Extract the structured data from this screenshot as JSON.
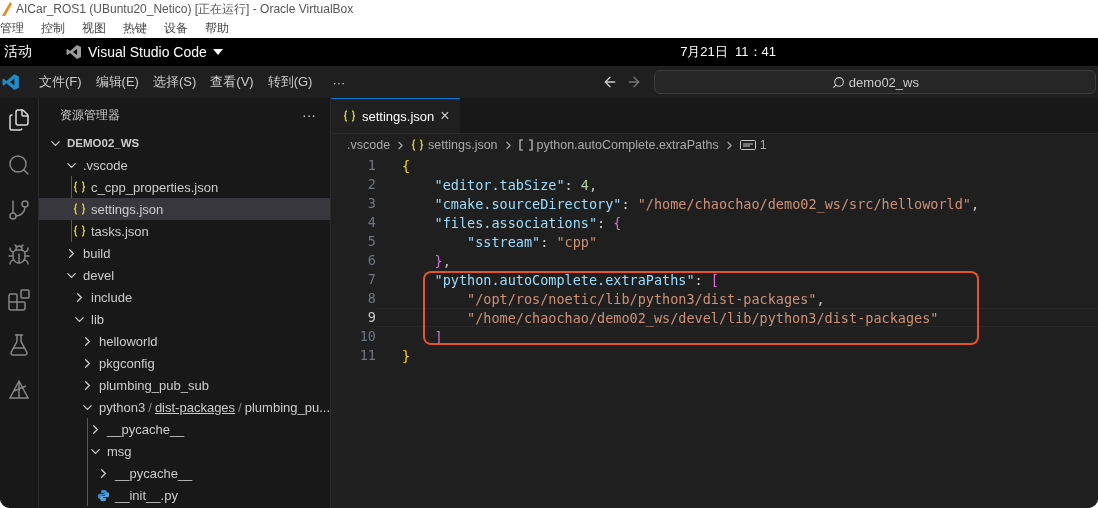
{
  "host_window": {
    "title": "AICar_ROS1 (UBuntu20_Netico) [正在运行] - Oracle VirtualBox",
    "menu": [
      "管理",
      "控制",
      "视图",
      "热键",
      "设备",
      "帮助"
    ]
  },
  "top_bar": {
    "activities": "活动",
    "app_name": "Visual Studio Code",
    "clock": "7月21日  11：41"
  },
  "title_bar": {
    "menu": [
      "文件(F)",
      "编辑(E)",
      "选择(S)",
      "查看(V)",
      "转到(G)"
    ],
    "more": "···",
    "search": {
      "value": "demo02_ws"
    }
  },
  "activity_bar": [
    {
      "kind": "explorer",
      "selected": true
    },
    {
      "kind": "search",
      "selected": false
    },
    {
      "kind": "git",
      "selected": false
    },
    {
      "kind": "debug",
      "selected": false
    },
    {
      "kind": "extensions",
      "selected": false
    },
    {
      "kind": "testing",
      "selected": false
    },
    {
      "kind": "ros",
      "selected": false
    }
  ],
  "sidebar": {
    "title": "资源管理器",
    "more": "···",
    "tree": [
      {
        "label": "DEMO02_WS",
        "kind": "root",
        "expanded": true,
        "selected": false,
        "children": [
          {
            "label": ".vscode",
            "kind": "folder",
            "expanded": true,
            "selected": false,
            "guide_line": true,
            "children": [
              {
                "label": "c_cpp_properties.json",
                "kind": "json",
                "selected": false
              },
              {
                "label": "settings.json",
                "kind": "json",
                "selected": true
              },
              {
                "label": "tasks.json",
                "kind": "json",
                "selected": false
              }
            ]
          },
          {
            "label": "build",
            "kind": "folder",
            "expanded": false,
            "selected": false
          },
          {
            "label": "devel",
            "kind": "folder",
            "expanded": true,
            "selected": false,
            "children": [
              {
                "label": "include",
                "kind": "folder",
                "expanded": false,
                "selected": false
              },
              {
                "label": "lib",
                "kind": "folder",
                "expanded": true,
                "selected": false,
                "children": [
                  {
                    "label": "helloworld",
                    "kind": "folder",
                    "expanded": false,
                    "selected": false
                  },
                  {
                    "label": "pkgconfig",
                    "kind": "folder",
                    "expanded": false,
                    "selected": false
                  },
                  {
                    "label": "plumbing_pub_sub",
                    "kind": "folder",
                    "expanded": false,
                    "selected": false
                  },
                  {
                    "kind": "folder",
                    "expanded": true,
                    "selected": false,
                    "guide_line": true,
                    "path": [
                      {
                        "text": "python3",
                        "kind": "name"
                      },
                      {
                        "text": "/",
                        "kind": "sep"
                      },
                      {
                        "text": "dist-packages",
                        "kind": "link"
                      },
                      {
                        "text": "/",
                        "kind": "sep"
                      },
                      {
                        "text": "plumbing_pu...",
                        "kind": "name"
                      }
                    ],
                    "children": [
                      {
                        "label": "__pycache__",
                        "kind": "folder",
                        "expanded": false,
                        "selected": false
                      },
                      {
                        "label": "msg",
                        "kind": "folder",
                        "expanded": true,
                        "selected": false,
                        "children": [
                          {
                            "label": "__pycache__",
                            "kind": "folder",
                            "expanded": false,
                            "selected": false
                          },
                          {
                            "label": "__init__.py",
                            "kind": "python",
                            "selected": false
                          }
                        ]
                      }
                    ]
                  }
                ]
              }
            ]
          }
        ]
      }
    ]
  },
  "tabs": [
    {
      "label": "settings.json",
      "kind": "json",
      "selected": true,
      "close": "×"
    }
  ],
  "breadcrumb": [
    {
      "text": ".vscode",
      "kind": "folder"
    },
    {
      "text": "settings.json",
      "kind": "json"
    },
    {
      "text": "python.autoComplete.extraPaths",
      "kind": "array"
    },
    {
      "text": "1",
      "kind": "string"
    }
  ],
  "code": [
    {
      "number": "1",
      "current": false,
      "highlighted": false,
      "tokens": [
        {
          "kind": "brace1",
          "text": "{"
        }
      ]
    },
    {
      "number": "2",
      "current": false,
      "highlighted": false,
      "tokens": [
        {
          "kind": "indent"
        },
        {
          "kind": "key",
          "text": "\"editor.tabSize\""
        },
        {
          "kind": "punct",
          "text": ": "
        },
        {
          "kind": "number",
          "text": "4"
        },
        {
          "kind": "punct",
          "text": ","
        }
      ]
    },
    {
      "number": "3",
      "current": false,
      "highlighted": false,
      "tokens": [
        {
          "kind": "indent"
        },
        {
          "kind": "key",
          "text": "\"cmake.sourceDirectory\""
        },
        {
          "kind": "punct",
          "text": ": "
        },
        {
          "kind": "string",
          "text": "\"/home/chaochao/demo02_ws/src/helloworld\""
        },
        {
          "kind": "punct",
          "text": ","
        }
      ]
    },
    {
      "number": "4",
      "current": false,
      "highlighted": false,
      "tokens": [
        {
          "kind": "indent"
        },
        {
          "kind": "key",
          "text": "\"files.associations\""
        },
        {
          "kind": "punct",
          "text": ": "
        },
        {
          "kind": "brace2",
          "text": "{"
        }
      ]
    },
    {
      "number": "5",
      "current": false,
      "highlighted": false,
      "tokens": [
        {
          "kind": "indent"
        },
        {
          "kind": "indent"
        },
        {
          "kind": "key",
          "text": "\"sstream\""
        },
        {
          "kind": "punct",
          "text": ": "
        },
        {
          "kind": "string",
          "text": "\"cpp\""
        }
      ]
    },
    {
      "number": "6",
      "current": false,
      "highlighted": false,
      "tokens": [
        {
          "kind": "indent"
        },
        {
          "kind": "brace2",
          "text": "}"
        },
        {
          "kind": "punct",
          "text": ","
        }
      ]
    },
    {
      "number": "7",
      "current": false,
      "highlighted": true,
      "tokens": [
        {
          "kind": "indent"
        },
        {
          "kind": "key",
          "text": "\"python.autoComplete.extraPaths\""
        },
        {
          "kind": "punct",
          "text": ": "
        },
        {
          "kind": "brace2",
          "text": "["
        }
      ]
    },
    {
      "number": "8",
      "current": false,
      "highlighted": true,
      "tokens": [
        {
          "kind": "indent"
        },
        {
          "kind": "indent"
        },
        {
          "kind": "string",
          "text": "\"/opt/ros/noetic/lib/python3/dist-packages\""
        },
        {
          "kind": "punct",
          "text": ","
        }
      ]
    },
    {
      "number": "9",
      "current": true,
      "highlighted": true,
      "tokens": [
        {
          "kind": "indent"
        },
        {
          "kind": "indent"
        },
        {
          "kind": "string",
          "text": "\"/home/chaochao/demo02_ws/devel/lib/python3/dist-packages\""
        }
      ]
    },
    {
      "number": "10",
      "current": false,
      "highlighted": true,
      "tokens": [
        {
          "kind": "indent"
        },
        {
          "kind": "brace2",
          "text": "]"
        }
      ]
    },
    {
      "number": "11",
      "current": false,
      "highlighted": false,
      "tokens": [
        {
          "kind": "brace1",
          "text": "}"
        }
      ]
    }
  ]
}
